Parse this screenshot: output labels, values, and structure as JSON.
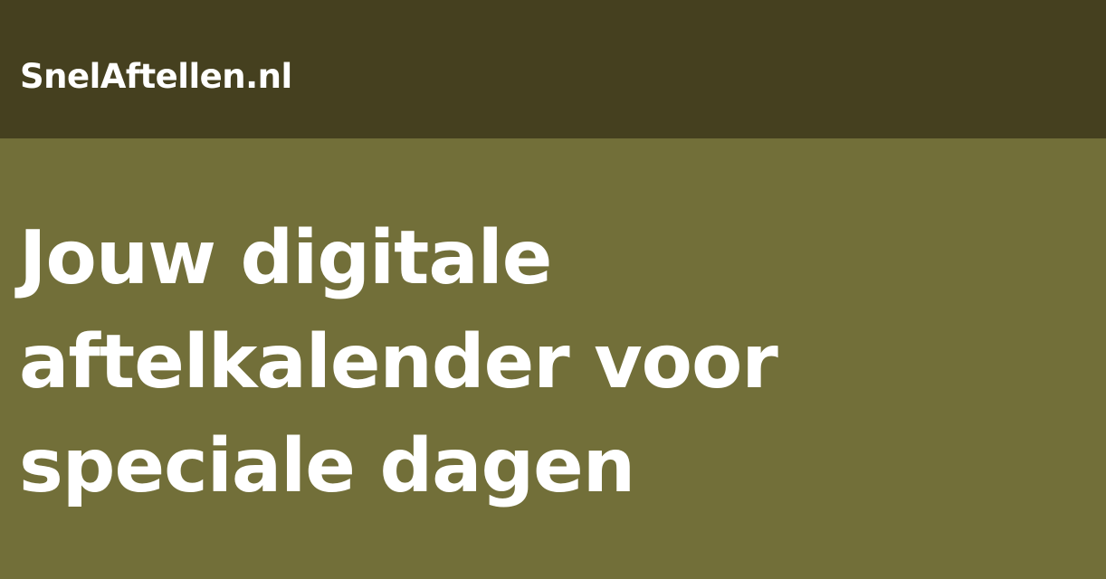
{
  "header": {
    "brand": "SnelAftellen.nl",
    "background_color": "#45401f"
  },
  "hero": {
    "background_color": "#726f39",
    "headline_lines": [
      "Jouw digitale",
      "aftelkalender voor",
      "speciale dagen"
    ]
  }
}
